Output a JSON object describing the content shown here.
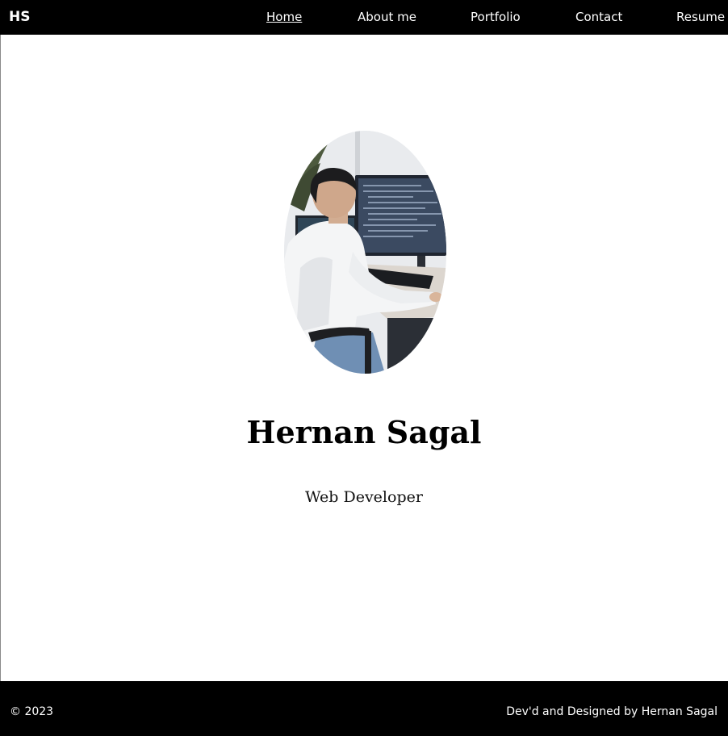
{
  "navbar": {
    "brand": "HS",
    "links": [
      {
        "label": "Home",
        "active": true
      },
      {
        "label": "About me",
        "active": false
      },
      {
        "label": "Portfolio",
        "active": false
      },
      {
        "label": "Contact",
        "active": false
      },
      {
        "label": "Resume",
        "active": false
      }
    ]
  },
  "hero": {
    "name": "Hernan Sagal",
    "role": "Web Developer",
    "photo_icon": "developer-at-desk-photo"
  },
  "footer": {
    "copyright": "© 2023",
    "credit": "Dev'd and Designed by Hernan Sagal"
  },
  "colors": {
    "navbar_bg": "#000000",
    "footer_bg": "#000000",
    "page_bg": "#ffffff",
    "text_on_dark": "#ffffff"
  }
}
